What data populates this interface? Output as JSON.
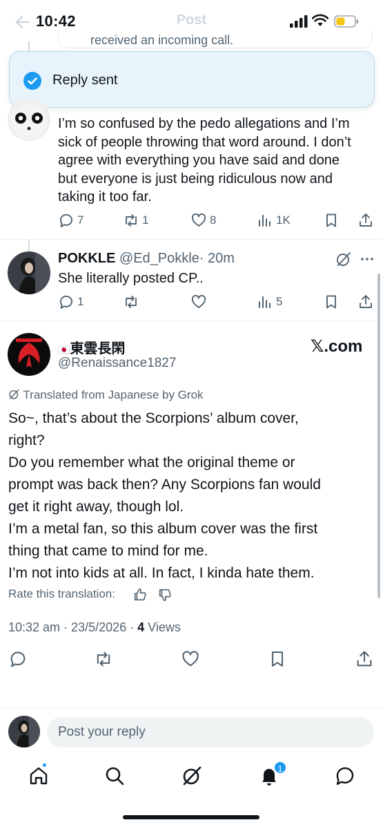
{
  "status_bar": {
    "time": "10:42"
  },
  "header": {
    "title": "Post",
    "quoted_snippet": "received an incoming call."
  },
  "toast": {
    "message": "Reply sent"
  },
  "reply1": {
    "text_lines": [
      "I’m so confused by the pedo allegations and I’m",
      "sick of people throwing that word around. I don’t",
      "agree with everything you have said and done",
      "but everyone is just being ridiculous now and",
      "taking it too far."
    ],
    "replies": "7",
    "reposts": "1",
    "likes": "8",
    "views": "1K"
  },
  "reply2": {
    "name": "POKKLE",
    "handle": "@Ed_Pokkle",
    "time": "· 20m",
    "text": "She literally posted CP..",
    "replies": "1",
    "views": "5"
  },
  "main_post": {
    "flag": "🇯🇵",
    "name": "東雲長閑",
    "handle": "@Renaissance1827",
    "watermark": "𝕏.com",
    "translated_label": "Translated from Japanese by Grok",
    "text_lines": [
      "So~, that’s about the Scorpions’ album cover,",
      "right?",
      "Do you remember what the original theme or",
      "prompt was back then? Any Scorpions fan would",
      "get it right away, though lol.",
      "I’m a metal fan, so this album cover was the first",
      "thing that came to mind for me.",
      "I’m not into kids at all. In fact, I kinda hate them."
    ],
    "rate_label": "Rate this translation:",
    "timestamp": "10:32 am · 23/5/2026 ·",
    "views_count": "4",
    "views_label": "Views"
  },
  "reply_bar": {
    "placeholder": "Post your reply"
  },
  "tabbar": {
    "notifications_badge": "1"
  },
  "colors": {
    "accent": "#1d9bf0",
    "text": "#0f1419",
    "secondary": "#536471"
  }
}
